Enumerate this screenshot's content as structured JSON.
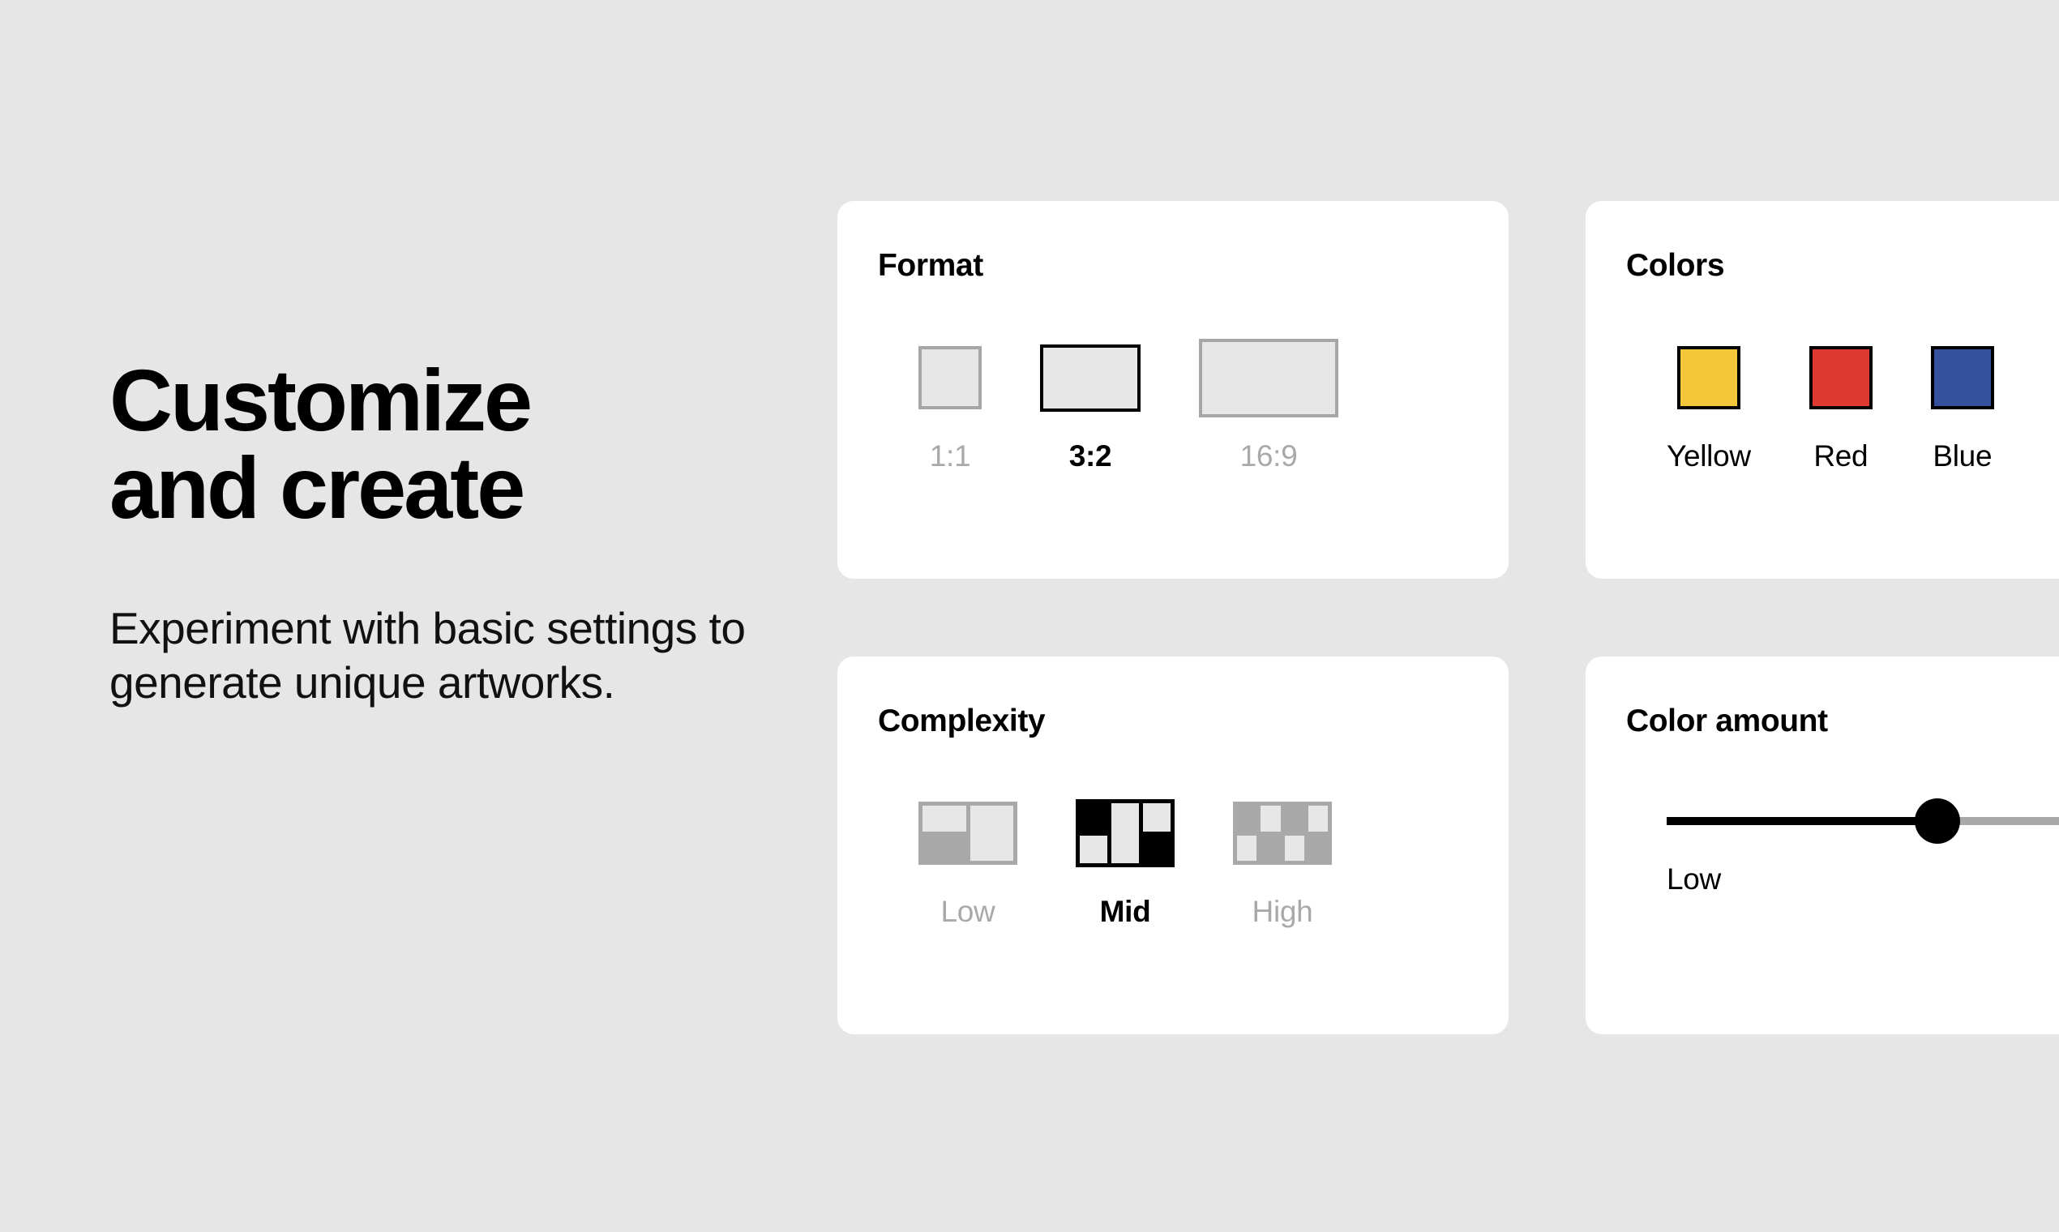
{
  "theme": {
    "background": "#e6e6e6",
    "card_background": "#ffffff",
    "text_primary": "#000000",
    "text_muted": "#a9a9a9",
    "swatch_border_unselected": "#a6a6a6",
    "swatch_border_selected": "#000000",
    "swatch_fill": "#e7e7e7"
  },
  "hero": {
    "title": "Customize\nand create",
    "subtitle": "Experiment with basic settings to generate unique artworks."
  },
  "cards": {
    "format": {
      "title": "Format",
      "options": [
        {
          "label": "1:1",
          "selected": false,
          "icon": "aspect-ratio-1-1-icon"
        },
        {
          "label": "3:2",
          "selected": true,
          "icon": "aspect-ratio-3-2-icon"
        },
        {
          "label": "16:9",
          "selected": false,
          "icon": "aspect-ratio-16-9-icon"
        }
      ]
    },
    "colors": {
      "title": "Colors",
      "options": [
        {
          "label": "Yellow",
          "hex": "#f5c83c",
          "selected": false,
          "icon": "color-swatch-yellow-icon"
        },
        {
          "label": "Red",
          "hex": "#df3a31",
          "selected": false,
          "icon": "color-swatch-red-icon"
        },
        {
          "label": "Blue",
          "hex": "#34519e",
          "selected": false,
          "icon": "color-swatch-blue-icon"
        }
      ]
    },
    "complexity": {
      "title": "Complexity",
      "options": [
        {
          "label": "Low",
          "selected": false,
          "icon": "grid-pattern-low-icon"
        },
        {
          "label": "Mid",
          "selected": true,
          "icon": "grid-pattern-mid-icon"
        },
        {
          "label": "High",
          "selected": false,
          "icon": "grid-pattern-high-icon"
        }
      ]
    },
    "color_amount": {
      "title": "Color amount",
      "value_label": "Low",
      "fill_percent": 38
    }
  }
}
